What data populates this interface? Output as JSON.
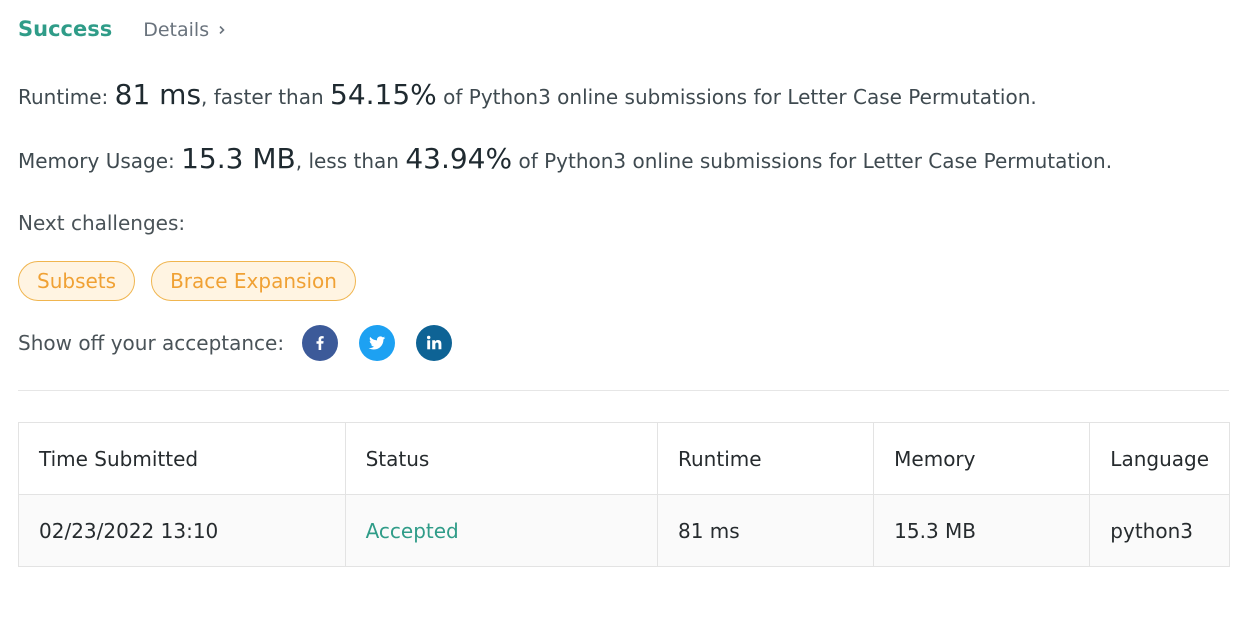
{
  "header": {
    "status": "Success",
    "details_label": "Details"
  },
  "runtime": {
    "label": "Runtime:",
    "value": "81 ms",
    "compare": ", faster than",
    "percent": "54.15%",
    "suffix": "of Python3 online submissions for Letter Case Permutation."
  },
  "memory": {
    "label": "Memory Usage:",
    "value": "15.3 MB",
    "compare": ", less than",
    "percent": "43.94%",
    "suffix": "of Python3 online submissions for Letter Case Permutation."
  },
  "next_challenges": {
    "label": "Next challenges:",
    "items": [
      "Subsets",
      "Brace Expansion"
    ]
  },
  "share": {
    "label": "Show off your acceptance:",
    "icons": [
      "facebook-icon",
      "twitter-icon",
      "linkedin-icon"
    ]
  },
  "submissions": {
    "columns": [
      "Time Submitted",
      "Status",
      "Runtime",
      "Memory",
      "Language"
    ],
    "rows": [
      [
        "02/23/2022 13:10",
        "Accepted",
        "81 ms",
        "15.3 MB",
        "python3"
      ]
    ]
  },
  "colors": {
    "success": "#2f9c88",
    "tag_border": "#f0b54f",
    "tag_text": "#f0a134",
    "facebook": "#3c5a99",
    "twitter": "#1da1f2",
    "linkedin": "#0e6395"
  }
}
